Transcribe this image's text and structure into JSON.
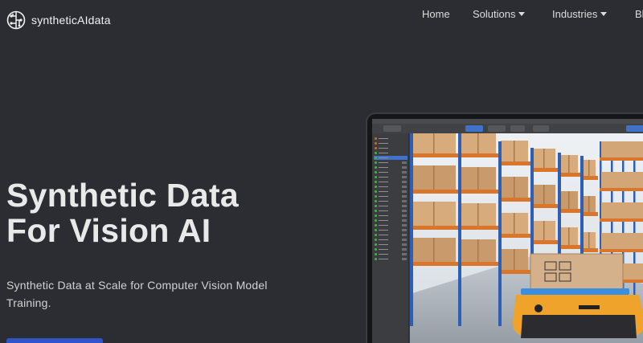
{
  "brand": {
    "name": "syntheticAIdata",
    "logo_icon": "brain-circuit-icon"
  },
  "nav": {
    "home": "Home",
    "solutions": "Solutions",
    "industries": "Industries",
    "blog": "Bl",
    "dropdown_icon": "caret-down-icon"
  },
  "hero": {
    "title_line1": "Synthetic Data",
    "title_line2": "For Vision AI",
    "subtitle": "Synthetic Data at Scale for Computer Vision Model Training."
  },
  "colors": {
    "background": "#2b2d33",
    "accent": "#2f55c9",
    "shelf_orange": "#d9762b",
    "shelf_blue": "#2c5fb5",
    "robot_yellow": "#f0a32a"
  }
}
